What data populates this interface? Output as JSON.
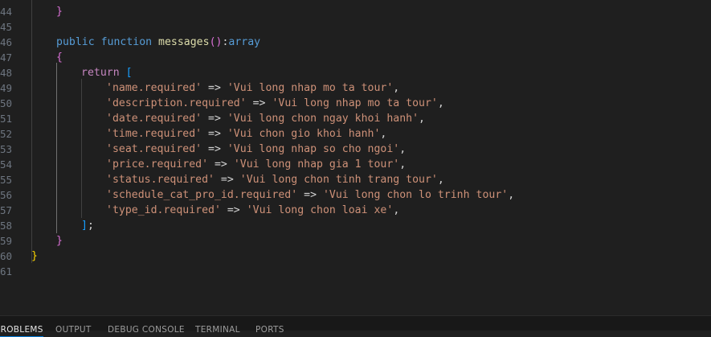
{
  "editor": {
    "lines": [
      {
        "n": "44",
        "ind": 1,
        "toks": [
          {
            "t": "}",
            "c": "br-pink"
          }
        ]
      },
      {
        "n": "45",
        "ind": 0,
        "toks": []
      },
      {
        "n": "46",
        "ind": 1,
        "toks": [
          {
            "t": "public ",
            "c": "kw-blue"
          },
          {
            "t": "function ",
            "c": "kw-blue"
          },
          {
            "t": "messages",
            "c": "fn"
          },
          {
            "t": "()",
            "c": "br-pink"
          },
          {
            "t": ":",
            "c": "op"
          },
          {
            "t": "array",
            "c": "kw-blue"
          }
        ]
      },
      {
        "n": "47",
        "ind": 1,
        "toks": [
          {
            "t": "{",
            "c": "br-pink"
          }
        ]
      },
      {
        "n": "48",
        "ind": 2,
        "toks": [
          {
            "t": "return ",
            "c": "kw-purple"
          },
          {
            "t": "[",
            "c": "br-blue"
          }
        ]
      },
      {
        "n": "49",
        "ind": 3,
        "toks": [
          {
            "t": "'name.required'",
            "c": "str"
          },
          {
            "t": " => ",
            "c": "op"
          },
          {
            "t": "'Vui long nhap mo ta tour'",
            "c": "str"
          },
          {
            "t": ",",
            "c": "op"
          }
        ]
      },
      {
        "n": "50",
        "ind": 3,
        "toks": [
          {
            "t": "'description.required'",
            "c": "str"
          },
          {
            "t": " => ",
            "c": "op"
          },
          {
            "t": "'Vui long nhap mo ta tour'",
            "c": "str"
          },
          {
            "t": ",",
            "c": "op"
          }
        ]
      },
      {
        "n": "51",
        "ind": 3,
        "toks": [
          {
            "t": "'date.required'",
            "c": "str"
          },
          {
            "t": " => ",
            "c": "op"
          },
          {
            "t": "'Vui long chon ngay khoi hanh'",
            "c": "str"
          },
          {
            "t": ",",
            "c": "op"
          }
        ]
      },
      {
        "n": "52",
        "ind": 3,
        "toks": [
          {
            "t": "'time.required'",
            "c": "str"
          },
          {
            "t": " => ",
            "c": "op"
          },
          {
            "t": "'Vui chon gio khoi hanh'",
            "c": "str"
          },
          {
            "t": ",",
            "c": "op"
          }
        ]
      },
      {
        "n": "53",
        "ind": 3,
        "toks": [
          {
            "t": "'seat.required'",
            "c": "str"
          },
          {
            "t": " => ",
            "c": "op"
          },
          {
            "t": "'Vui long nhap so cho ngoi'",
            "c": "str"
          },
          {
            "t": ",",
            "c": "op"
          }
        ]
      },
      {
        "n": "54",
        "ind": 3,
        "toks": [
          {
            "t": "'price.required'",
            "c": "str"
          },
          {
            "t": " => ",
            "c": "op"
          },
          {
            "t": "'Vui long nhap gia 1 tour'",
            "c": "str"
          },
          {
            "t": ",",
            "c": "op"
          }
        ]
      },
      {
        "n": "55",
        "ind": 3,
        "toks": [
          {
            "t": "'status.required'",
            "c": "str"
          },
          {
            "t": " => ",
            "c": "op"
          },
          {
            "t": "'Vui long chon tinh trang tour'",
            "c": "str"
          },
          {
            "t": ",",
            "c": "op"
          }
        ]
      },
      {
        "n": "56",
        "ind": 3,
        "toks": [
          {
            "t": "'schedule_cat_pro_id.required'",
            "c": "str"
          },
          {
            "t": " => ",
            "c": "op"
          },
          {
            "t": "'Vui long chon lo trinh tour'",
            "c": "str"
          },
          {
            "t": ",",
            "c": "op"
          }
        ]
      },
      {
        "n": "57",
        "ind": 3,
        "toks": [
          {
            "t": "'type_id.required'",
            "c": "str"
          },
          {
            "t": " => ",
            "c": "op"
          },
          {
            "t": "'Vui long chon loai xe'",
            "c": "str"
          },
          {
            "t": ",",
            "c": "op"
          }
        ]
      },
      {
        "n": "58",
        "ind": 2,
        "toks": [
          {
            "t": "]",
            "c": "br-blue"
          },
          {
            "t": ";",
            "c": "op"
          }
        ]
      },
      {
        "n": "59",
        "ind": 1,
        "toks": [
          {
            "t": "}",
            "c": "br-pink"
          }
        ]
      },
      {
        "n": "60",
        "ind": 0,
        "toks": [
          {
            "t": "}",
            "c": "br-gold"
          }
        ]
      },
      {
        "n": "61",
        "ind": 0,
        "toks": []
      }
    ]
  },
  "panel": {
    "tabs": [
      "PROBLEMS",
      "OUTPUT",
      "DEBUG CONSOLE",
      "TERMINAL",
      "PORTS"
    ]
  }
}
